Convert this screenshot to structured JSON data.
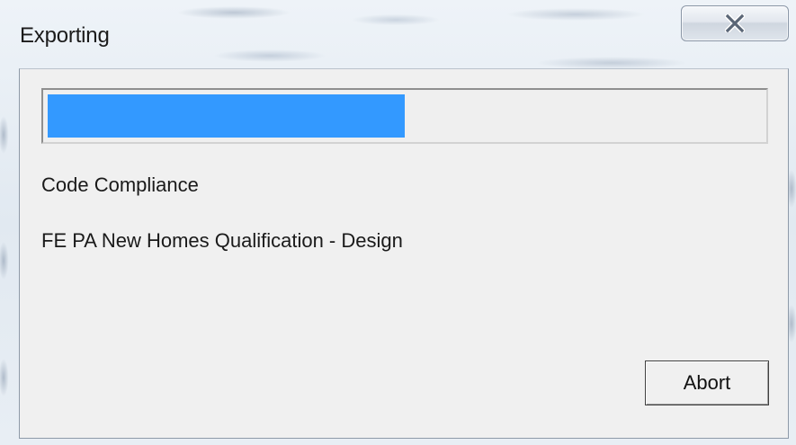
{
  "window": {
    "title": "Exporting",
    "close_icon": "close-icon"
  },
  "progress": {
    "fraction": 0.5,
    "fill_color": "#3399ff"
  },
  "status": {
    "line1": "Code Compliance",
    "line2": "FE PA New Homes Qualification - Design"
  },
  "buttons": {
    "abort_label": "Abort"
  }
}
